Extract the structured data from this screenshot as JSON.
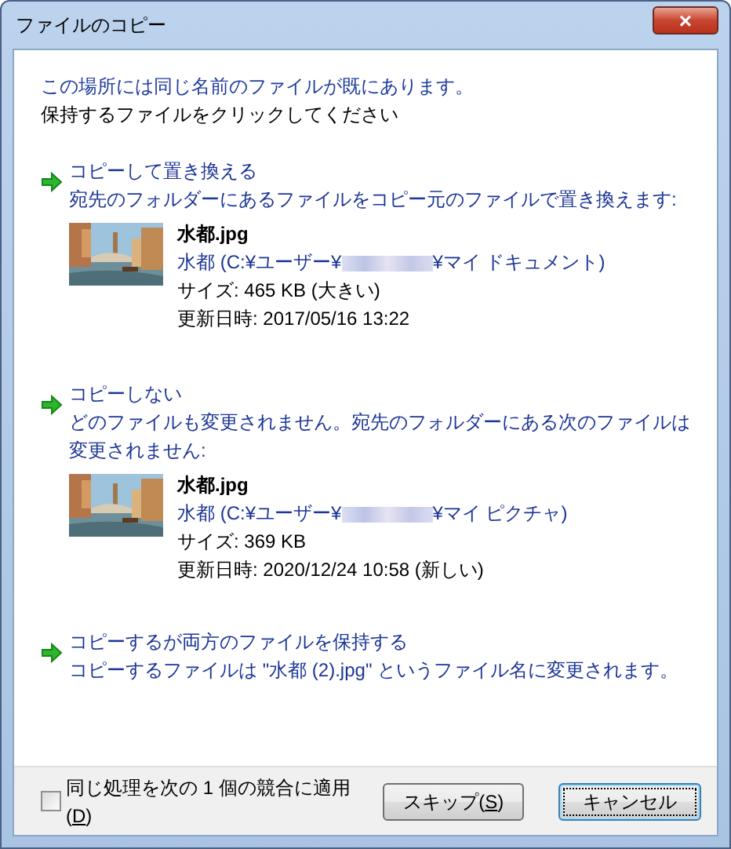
{
  "window": {
    "title": "ファイルのコピー",
    "close": "×"
  },
  "message": "この場所には同じ名前のファイルが既にあります。",
  "instruction": "保持するファイルをクリックしてください",
  "options": [
    {
      "kind": "file",
      "title": "コピーして置き換える",
      "description": "宛先のフォルダーにあるファイルをコピー元のファイルで置き換えます:",
      "file": {
        "name": "水都.jpg",
        "path_before": "水都 (C:¥ユーザー¥",
        "path_after": "¥マイ ドキュメント)",
        "size": "サイズ: 465 KB (大きい)",
        "modified": "更新日時: 2017/05/16 13:22"
      }
    },
    {
      "kind": "file",
      "title": "コピーしない",
      "description": "どのファイルも変更されません。宛先のフォルダーにある次のファイルは変更されません:",
      "file": {
        "name": "水都.jpg",
        "path_before": "水都 (C:¥ユーザー¥",
        "path_after": "¥マイ ピクチャ)",
        "size": "サイズ: 369 KB",
        "modified": "更新日時: 2020/12/24 10:58 (新しい)"
      }
    },
    {
      "kind": "plain",
      "title": "コピーするが両方のファイルを保持する",
      "description": "コピーするファイルは \"水都 (2).jpg\" というファイル名に変更されます。"
    }
  ],
  "apply_all": {
    "checked": false,
    "label_before": "同じ処理を次の 1 個の競合に適用(",
    "access_key": "D",
    "label_after": ")"
  },
  "buttons": [
    {
      "label_before": "スキップ(",
      "access_key": "S",
      "label_after": ")",
      "focused": false
    },
    {
      "label_before": "キャンセル",
      "focused": true
    }
  ]
}
